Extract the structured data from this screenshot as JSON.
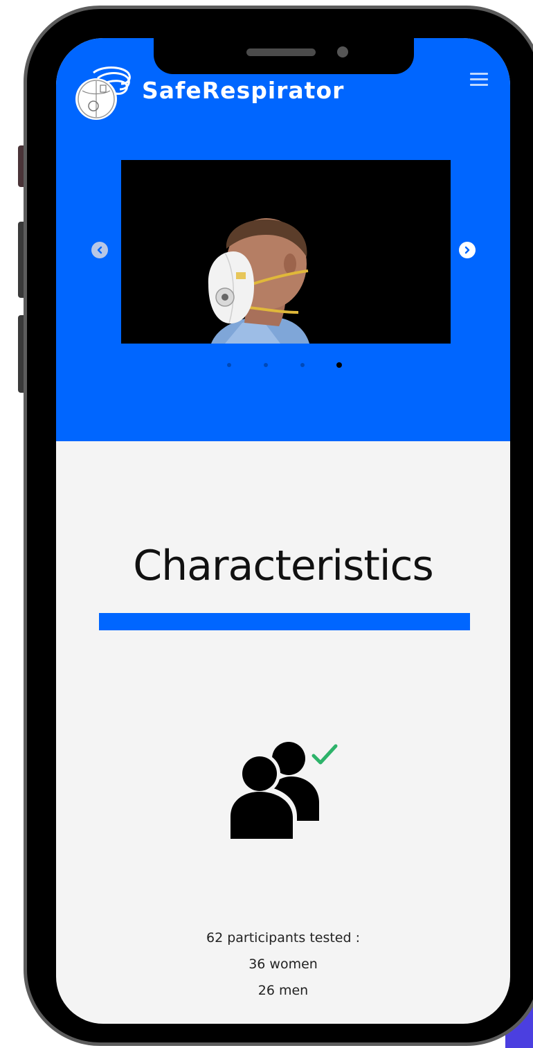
{
  "colors": {
    "brand_blue": "#0066ff",
    "page_background": "#f4f4f4",
    "check_green": "#2db36a",
    "phone_frame": "#000000"
  },
  "header": {
    "brand_name": "SafeRespirator",
    "logo_icon": "respirator-mask-logo",
    "menu_icon": "hamburger-menu-icon"
  },
  "carousel": {
    "prev_icon": "chevron-left-icon",
    "next_icon": "chevron-right-icon",
    "slide_image": "man-wearing-respirator-photo",
    "dot_count": 4,
    "active_dot": 4
  },
  "characteristics": {
    "title": "Characteristics",
    "icon": "participants-check-icon",
    "stats": {
      "total": "62 participants tested :",
      "women": "36 women",
      "men": "26 men"
    }
  }
}
